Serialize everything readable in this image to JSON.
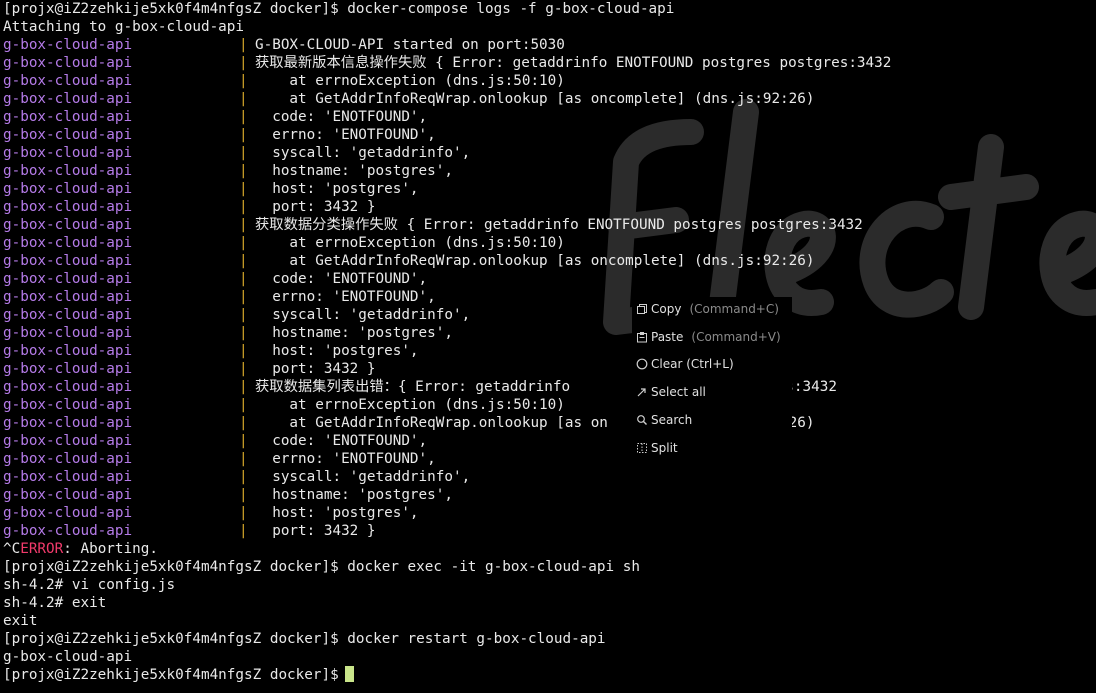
{
  "colors": {
    "background": "#000000",
    "text": "#e9e9e9",
    "service_prefix": "#b57be8",
    "pipe": "#d4a52a",
    "error_word": "#f13a6b",
    "cursor": "#c9e58a",
    "shortcut": "#8a8a8a"
  },
  "header": {
    "command_line": "[projx@iZ2zehkije5xk0f4m4nfgsZ docker]$ docker-compose logs -f g-box-cloud-api",
    "attaching": "Attaching to g-box-cloud-api"
  },
  "log": {
    "service": "g-box-cloud-api",
    "pipe": "|",
    "lines": [
      "G-BOX-CLOUD-API started on port:5030",
      "获取最新版本信息操作失败 { Error: getaddrinfo ENOTFOUND postgres postgres:3432",
      "    at errnoException (dns.js:50:10)",
      "    at GetAddrInfoReqWrap.onlookup [as oncomplete] (dns.js:92:26)",
      "  code: 'ENOTFOUND',",
      "  errno: 'ENOTFOUND',",
      "  syscall: 'getaddrinfo',",
      "  hostname: 'postgres',",
      "  host: 'postgres',",
      "  port: 3432 }",
      "获取数据分类操作失败 { Error: getaddrinfo ENOTFOUND postgres postgres:3432",
      "    at errnoException (dns.js:50:10)",
      "    at GetAddrInfoReqWrap.onlookup [as oncomplete] (dns.js:92:26)",
      "  code: 'ENOTFOUND',",
      "  errno: 'ENOTFOUND',",
      "  syscall: 'getaddrinfo',",
      "  hostname: 'postgres',",
      "  host: 'postgres',",
      "  port: 3432 }",
      "获取数据集列表出错：{ Error: getaddrinfo                  postgres:3432",
      "    at errnoException (dns.js:50:10)",
      "    at GetAddrInfoReqWrap.onlookup [as on                  92:26)",
      "  code: 'ENOTFOUND',",
      "  errno: 'ENOTFOUND',",
      "  syscall: 'getaddrinfo',",
      "  hostname: 'postgres',",
      "  host: 'postgres',",
      "  port: 3432 }"
    ]
  },
  "footer": {
    "abort_prefix": "^C",
    "abort_error": "ERROR",
    "abort_suffix": ": Aborting.",
    "lines": [
      "[projx@iZ2zehkije5xk0f4m4nfgsZ docker]$ docker exec -it g-box-cloud-api sh",
      "sh-4.2# vi config.js",
      "sh-4.2# exit",
      "exit",
      "[projx@iZ2zehkije5xk0f4m4nfgsZ docker]$ docker restart g-box-cloud-api",
      "g-box-cloud-api"
    ],
    "prompt": "[projx@iZ2zehkije5xk0f4m4nfgsZ docker]$"
  },
  "context_menu": {
    "items": [
      {
        "label": "Copy",
        "shortcut": "(Command+C)",
        "icon": "copy-icon"
      },
      {
        "label": "Paste",
        "shortcut": "(Command+V)",
        "icon": "paste-icon"
      },
      {
        "label": "Clear (Ctrl+L)",
        "shortcut": "",
        "icon": "clear-icon"
      },
      {
        "label": "Select all",
        "shortcut": "",
        "icon": "select-all-icon"
      },
      {
        "label": "Search",
        "shortcut": "",
        "icon": "search-icon"
      },
      {
        "label": "Split",
        "shortcut": "",
        "icon": "split-icon"
      }
    ]
  }
}
